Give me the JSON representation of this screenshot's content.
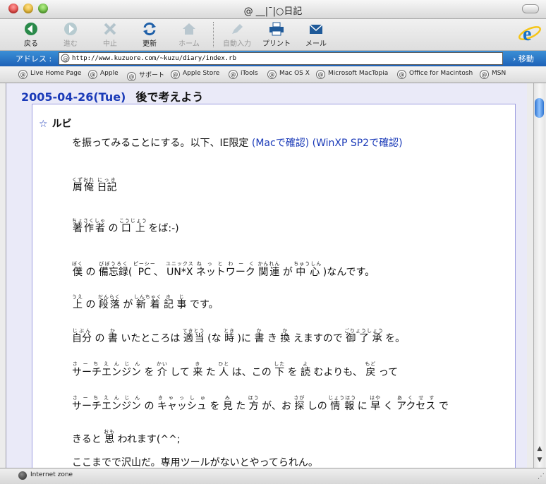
{
  "window": {
    "title": "@ __|¯|○日記"
  },
  "toolbar": {
    "back": "戻る",
    "forward": "進む",
    "stop": "中止",
    "refresh": "更新",
    "home": "ホーム",
    "autofill": "自動入力",
    "print": "プリント",
    "mail": "メール"
  },
  "address": {
    "label": "アドレス :",
    "url": "http://www.kuzuore.com/~kuzu/diary/index.rb",
    "go": "移動"
  },
  "favorites": [
    "Live Home Page",
    "Apple",
    "サポート",
    "Apple Store",
    "iTools",
    "Mac OS X",
    "Microsoft MacTopia",
    "Office for Macintosh",
    "MSN"
  ],
  "diary": {
    "date": "2005-04-26(Tue)",
    "title": "後で考えよう",
    "section_star": "☆",
    "section_title": "ルビ",
    "intro": "を振ってみることにする。以下、IE限定 ",
    "link1": "(Macで確認)",
    "link2": "(WinXP SP2で確認)",
    "r1": {
      "base1": "屑俺",
      "rt1": "くずおれ",
      "sep": " ",
      "base2": "日記",
      "rt2": "にっき"
    },
    "r2": {
      "base1": "著作者",
      "rt1": "ちょさくしゃ",
      "mid": " の ",
      "base2": "口上",
      "rt2": "こうじょう",
      "tail": " をば:-)"
    },
    "r3": {
      "b1": "僕",
      "t1": "ぼく",
      "s1": " の ",
      "b2": "備忘録",
      "t2": "びぼうろく",
      "s2": "( ",
      "b3": "PC",
      "t3": "ピーシー",
      "s3": "、 ",
      "b4": "UN*X",
      "t4": "ユニックス",
      "s4": " ",
      "b5": "ネットワーク",
      "t5": "ね っ と わ ー く",
      "s5": " ",
      "b6": "関連",
      "t6": "かんれん",
      "s6": " が ",
      "b7": "中心",
      "t7": "ちゅうしん",
      "tail": " )なんです。"
    },
    "r4": {
      "b1": "上",
      "t1": "うえ",
      "s1": " の ",
      "b2": "段落",
      "t2": "だんらく",
      "s2": " が ",
      "b3": "新着",
      "t3": "しんちゃく",
      "s3": " ",
      "b4": "記",
      "t4": "き",
      "s4": " ",
      "b5": "事",
      "t5": "じ",
      "tail": " です。"
    },
    "r5": {
      "b1": "自分",
      "t1": "じぶん",
      "s1": " の ",
      "b2": "書",
      "t2": "か",
      "s2": " いたところは ",
      "b3": "適当",
      "t3": "てきとう",
      "s3": " (な ",
      "b4": "時",
      "t4": "とき",
      "s4": " )に ",
      "b5": "書",
      "t5": "か",
      "s5": " き ",
      "b6": "換",
      "t6": "か",
      "s6": " えますので ",
      "b7": "御了承",
      "t7": "ごりょうしょう",
      "tail": " を。"
    },
    "r6": {
      "b1": "サーチエンジン",
      "t1": "さ ー ち え ん じ ん",
      "s1": " を ",
      "b2": "介",
      "t2": "かい",
      "s2": " して ",
      "b3": "来",
      "t3": "き",
      "s3": " た ",
      "b4": "人",
      "t4": "ひと",
      "s4": " は、この ",
      "b5": "下",
      "t5": "した",
      "s5": " を ",
      "b6": "読",
      "t6": "よ",
      "s6": " むよりも、 ",
      "b7": "戻",
      "t7": "もど",
      "tail": " って"
    },
    "r7": {
      "b1": "サーチエンジン",
      "t1": "さ ー ち え ん じ ん",
      "s1": " の ",
      "b2": "キャッシュ",
      "t2": "き ゃ っ し ゅ",
      "s2": " を ",
      "b3": "見",
      "t3": "み",
      "s3": " た ",
      "b4": "方",
      "t4": "ほう",
      "s4": " が、お ",
      "b5": "探",
      "t5": "さが",
      "s5": " しの ",
      "b6": "情報",
      "t6": "じょうほう",
      "s6": " に ",
      "b7": "早",
      "t7": "はや",
      "s7": " く ",
      "b8": "アクセス",
      "t8": "あ く せ す",
      "tail": " で"
    },
    "r8": {
      "pre": "きると ",
      "b1": "思",
      "t1": "おも",
      "tail": " われます(^^;"
    },
    "last": "ここまでで沢山だ。専用ツールがないとやってられん。"
  },
  "status": {
    "zone": "Internet zone"
  },
  "colors": {
    "link": "#1a3ab8",
    "address_bar": "#2a78c8"
  }
}
